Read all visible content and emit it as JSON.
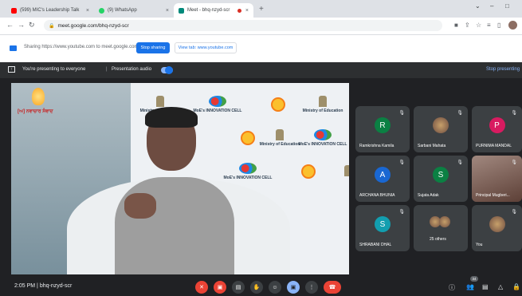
{
  "tabs": [
    {
      "label": "(599) MIC's Leadership Talk",
      "close": "×",
      "favicon_color": "#ff0000"
    },
    {
      "label": "(9) WhatsApp",
      "close": "×",
      "favicon_color": "#25d366"
    },
    {
      "label": "Meet - bhq-nzyd-scr",
      "close": "×",
      "favicon_color": "#00897b"
    }
  ],
  "new_tab": "+",
  "window": {
    "minimize": "⌄",
    "restore": "–",
    "maximize": "□"
  },
  "address": {
    "url": "meet.google.com/bhq-nzyd-scr"
  },
  "sharing": {
    "text": "Sharing https://www.youtube.com to meet.google.com",
    "stop_label": "Stop sharing",
    "switch_label": "View tab: www.youtube.com"
  },
  "meet_header": {
    "presenting": "You're presenting to everyone",
    "audio": "Presentation audio",
    "stop": "Stop presenting"
  },
  "video": {
    "ministry": "Ministry of Education",
    "ministry_line1": "Ministry of",
    "ministry_line2": "Education",
    "innovation": "MoE's INNOVATION CELL",
    "channel_title": "[ਅ] ਨਵਾਚਾਰ ਸੰਵਾਦ"
  },
  "participants": [
    {
      "name": "Ramkrishna Kamila",
      "initial": "R",
      "color": "#0b8043"
    },
    {
      "name": "Sarbani Mahata",
      "initial": "",
      "color": ""
    },
    {
      "name": "PURNIMA MANDAL",
      "initial": "P",
      "color": "#d81b60"
    },
    {
      "name": "ARCHANA BHUNIA",
      "initial": "A",
      "color": "#1967d2"
    },
    {
      "name": "Sujata Adak",
      "initial": "S",
      "color": "#0b8043"
    },
    {
      "name": "Principal Mugberi...",
      "initial": "",
      "color": ""
    },
    {
      "name": "SHRABANI DHAL",
      "initial": "S",
      "color": "#129eaf"
    },
    {
      "name": "25 others",
      "initial": "",
      "color": ""
    },
    {
      "name": "You",
      "initial": "",
      "color": ""
    }
  ],
  "bottom": {
    "time": "2:05 PM",
    "separator": "|",
    "meeting_code": "bhq-nzyd-scr",
    "participant_count": "34"
  }
}
